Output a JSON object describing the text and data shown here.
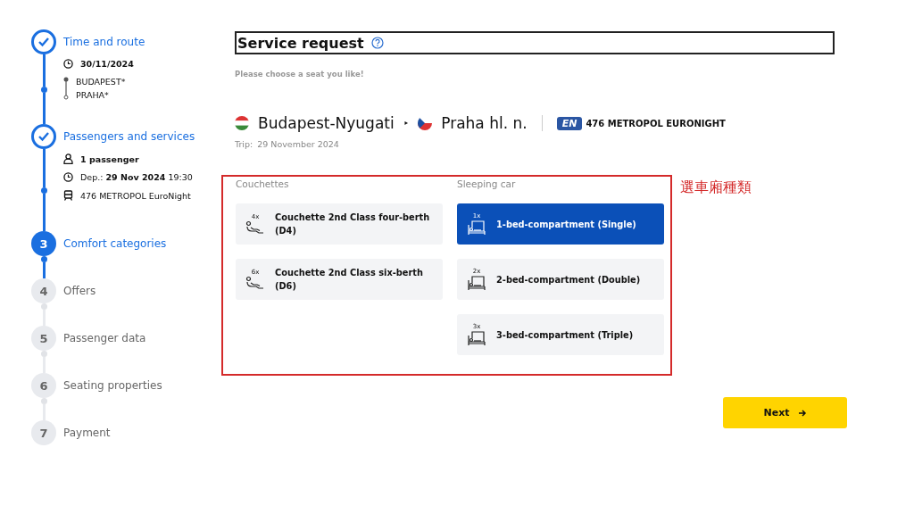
{
  "steps": [
    {
      "title": "Time and route",
      "done": true,
      "current": false,
      "details": [
        {
          "kind": "date",
          "text": "30/11/2024"
        },
        {
          "kind": "route",
          "from": "BUDAPEST*",
          "to": "PRAHA*"
        }
      ]
    },
    {
      "title": "Passengers and services",
      "done": true,
      "current": false,
      "details": [
        {
          "kind": "passenger",
          "text": "1 passenger"
        },
        {
          "kind": "departure",
          "text": "Dep.: **29 Nov 2024** 19:30"
        },
        {
          "kind": "train",
          "text": "476 METROPOL EuroNight"
        }
      ]
    },
    {
      "number": "3",
      "title": "Comfort categories",
      "done": false,
      "current": true
    },
    {
      "number": "4",
      "title": "Offers",
      "done": false,
      "current": false
    },
    {
      "number": "5",
      "title": "Passenger data",
      "done": false,
      "current": false
    },
    {
      "number": "6",
      "title": "Seating properties",
      "done": false,
      "current": false
    },
    {
      "number": "7",
      "title": "Payment",
      "done": false,
      "current": false
    }
  ],
  "header": {
    "title": "Service request",
    "subtitle": "Please choose a seat you like!"
  },
  "journey": {
    "from": {
      "name": "Budapest-Nyugati",
      "kind": "hu"
    },
    "to": {
      "name": "Praha hl. n.",
      "kind": "cz"
    },
    "separator": "‣",
    "train_badge": "EN",
    "train": "476 METROPOL EURONIGHT",
    "trip_label": "Trip:",
    "trip_date": "29 November 2024"
  },
  "categories": [
    {
      "heading": "Couchettes",
      "options": [
        {
          "kind": "couchette",
          "count": "4x",
          "label": "Couchette 2nd Class four-berth (D4)",
          "selected": false
        },
        {
          "kind": "couchette",
          "count": "6x",
          "label": "Couchette 2nd Class six-berth (D6)",
          "selected": false
        }
      ]
    },
    {
      "heading": "Sleeping car",
      "options": [
        {
          "kind": "bed",
          "count": "1x",
          "label": "1-bed-compartment (Single)",
          "selected": true
        },
        {
          "kind": "bed",
          "count": "2x",
          "label": "2-bed-compartment (Double)",
          "selected": false
        },
        {
          "kind": "bed",
          "count": "3x",
          "label": "3-bed-compartment (Triple)",
          "selected": false
        }
      ]
    }
  ],
  "annotation": "選車廂種類",
  "next_button": "Next"
}
